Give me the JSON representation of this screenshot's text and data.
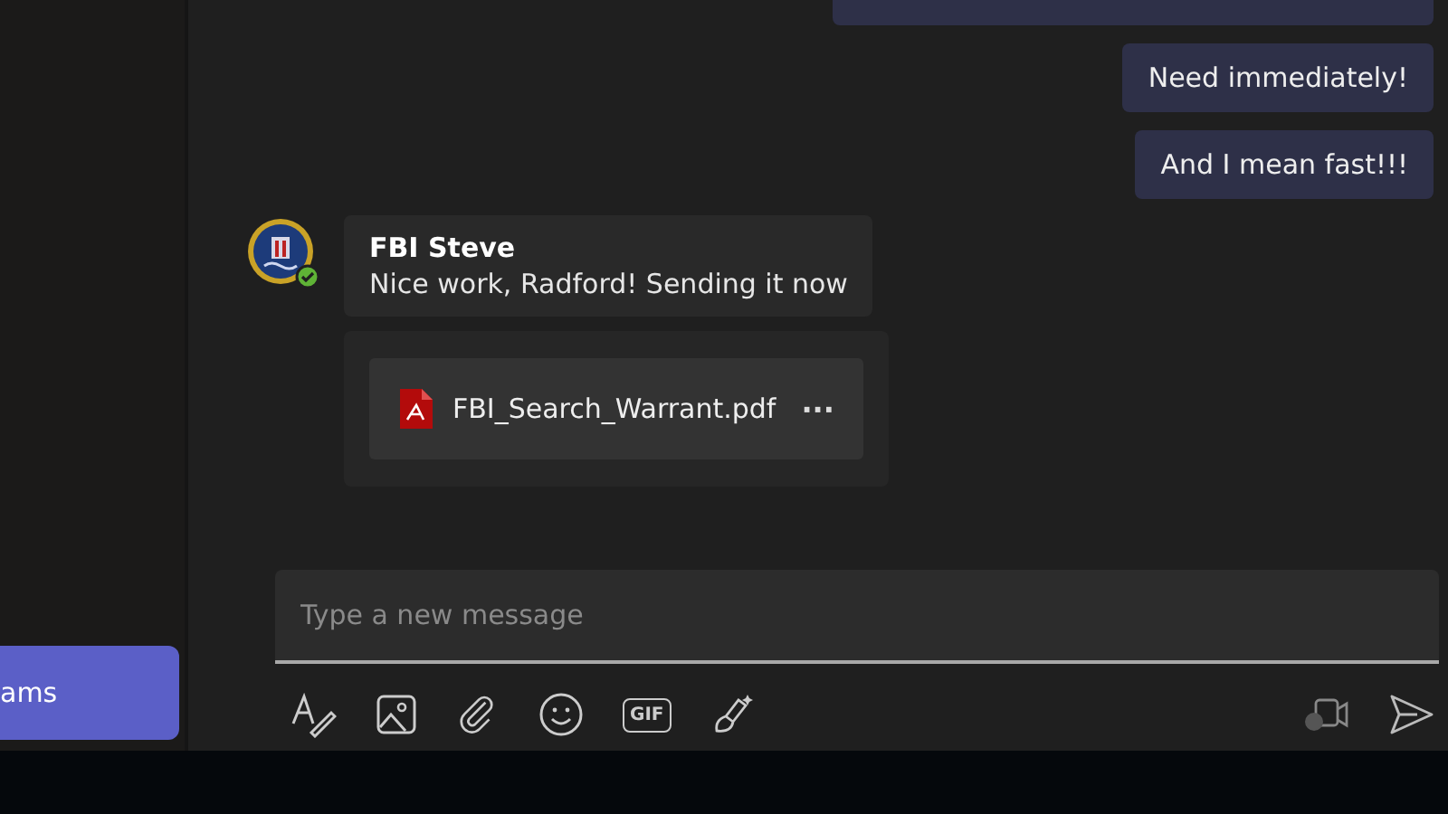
{
  "sidebar": {
    "button": {
      "label": "ams"
    }
  },
  "outgoing_messages": [
    {
      "text": "Need immediately!"
    },
    {
      "text": "And I mean fast!!!"
    }
  ],
  "incoming_message": {
    "sender": "FBI Steve",
    "text": "Nice work, Radford! Sending it now",
    "attachment": {
      "file_name": "FBI_Search_Warrant.pdf",
      "more": "···"
    }
  },
  "compose": {
    "placeholder": "Type a new message",
    "tools": [
      {
        "kind": "format"
      },
      {
        "kind": "image"
      },
      {
        "kind": "attach"
      },
      {
        "kind": "emoji"
      },
      {
        "kind": "gif",
        "label": "GIF"
      },
      {
        "kind": "sticker"
      }
    ]
  }
}
